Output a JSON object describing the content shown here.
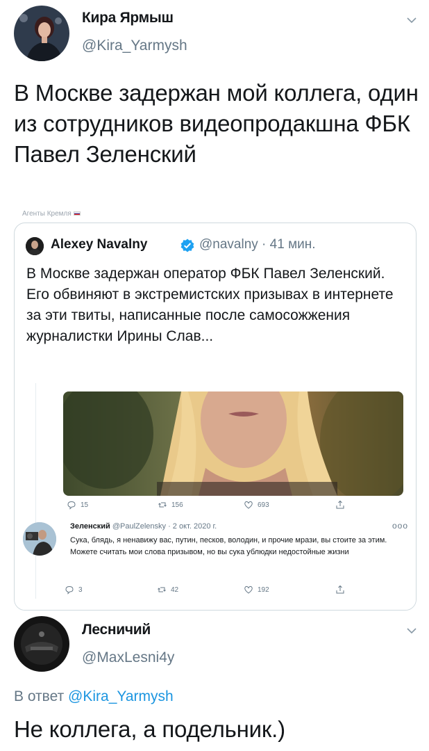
{
  "tweet": {
    "author_name": "Кира Ярмыш",
    "author_handle": "@Kira_Yarmysh",
    "text": "В Москве задержан мой коллега, один из сотрудников видеопродакшна ФБК Павел Зеленский"
  },
  "watermark": "Агенты Кремля",
  "quoted": {
    "author_name": "Alexey Navalny",
    "meta": "@navalny · 41 мин.",
    "text": "В Москве задержан оператор ФБК Павел Зеленский. Его обвиняют в экстремистских призывах в интернете за эти твиты, написанные после самосожжения журналистки Ирины Слав...",
    "embed": {
      "actions": {
        "reply": "15",
        "retweet": "156",
        "like": "693"
      },
      "reply_author": "Зеленский",
      "reply_meta": "@PaulZelensky · 2 окт. 2020 г.",
      "reply_text": "Сука, блядь, я ненавижу вас, путин, песков, володин, и прочие мрази, вы стоите за этим. Можете считать мои слова призывом, но вы сука ублюдки недостойные жизни",
      "reply_actions": {
        "reply": "3",
        "retweet": "42",
        "like": "192"
      }
    }
  },
  "reply": {
    "author_name": "Лесничий",
    "author_handle": "@MaxLesni4y",
    "reply_to_prefix": "В ответ",
    "reply_to_handle": "@Kira_Yarmysh",
    "text": "Не коллега, а подельник.)"
  },
  "colors": {
    "text": "#14171a",
    "secondary": "#657786",
    "link": "#1b95e0",
    "verified": "#1da1f2",
    "border": "#cfd9de"
  }
}
